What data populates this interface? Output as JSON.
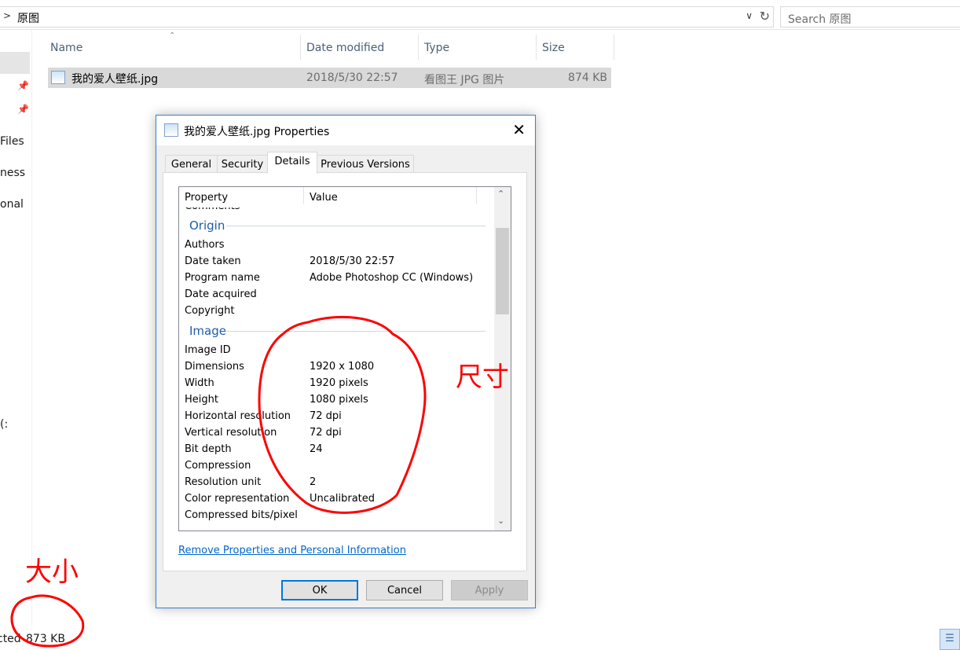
{
  "explorer": {
    "breadcrumb": "原图",
    "search_placeholder": "Search 原图",
    "nav_items": [
      "Files",
      "ness",
      "onal",
      ":)"
    ],
    "columns": [
      "Name",
      "Date modified",
      "Type",
      "Size"
    ],
    "file": {
      "name": "我的爱人壁纸.jpg",
      "date": "2018/5/30 22:57",
      "type": "看图王 JPG 图片",
      "size": "874 KB"
    },
    "status": {
      "selected_text": "cted",
      "size_text": "873 KB"
    }
  },
  "dialog": {
    "title": "我的爱人壁纸.jpg Properties",
    "tabs": [
      "General",
      "Security",
      "Details",
      "Previous Versions"
    ],
    "active_tab": "Details",
    "headers": {
      "property": "Property",
      "value": "Value"
    },
    "clipped_row": "Comments",
    "groups": [
      {
        "name": "Origin",
        "rows": [
          {
            "property": "Authors",
            "value": ""
          },
          {
            "property": "Date taken",
            "value": "2018/5/30 22:57"
          },
          {
            "property": "Program name",
            "value": "Adobe Photoshop CC (Windows)"
          },
          {
            "property": "Date acquired",
            "value": ""
          },
          {
            "property": "Copyright",
            "value": ""
          }
        ]
      },
      {
        "name": "Image",
        "rows": [
          {
            "property": "Image ID",
            "value": ""
          },
          {
            "property": "Dimensions",
            "value": "1920 x 1080"
          },
          {
            "property": "Width",
            "value": "1920 pixels"
          },
          {
            "property": "Height",
            "value": "1080 pixels"
          },
          {
            "property": "Horizontal resolution",
            "value": "72 dpi"
          },
          {
            "property": "Vertical resolution",
            "value": "72 dpi"
          },
          {
            "property": "Bit depth",
            "value": "24"
          },
          {
            "property": "Compression",
            "value": ""
          },
          {
            "property": "Resolution unit",
            "value": "2"
          },
          {
            "property": "Color representation",
            "value": "Uncalibrated"
          },
          {
            "property": "Compressed bits/pixel",
            "value": ""
          }
        ]
      }
    ],
    "link": "Remove Properties and Personal Information",
    "buttons": {
      "ok": "OK",
      "cancel": "Cancel",
      "apply": "Apply"
    }
  },
  "annotations": {
    "dimension_label": "尺寸",
    "size_label": "大小",
    "color": "#ff0000"
  }
}
